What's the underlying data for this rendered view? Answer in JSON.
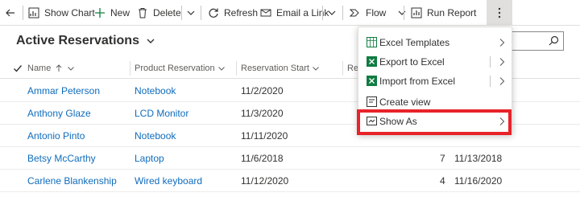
{
  "toolbar": {
    "show_chart": "Show Chart",
    "new": "New",
    "delete": "Delete",
    "refresh": "Refresh",
    "email_link": "Email a Link",
    "flow": "Flow",
    "run_report": "Run Report"
  },
  "view": {
    "title": "Active Reservations"
  },
  "columns": {
    "name": "Name",
    "product": "Product Reservation",
    "start": "Reservation Start",
    "fourth": "Res"
  },
  "rows": [
    {
      "name": "Ammar Peterson",
      "product": "Notebook",
      "start": "11/2/2020",
      "qty": "",
      "end": ""
    },
    {
      "name": "Anthony Glaze",
      "product": "LCD Monitor",
      "start": "11/3/2020",
      "qty": "",
      "end": ""
    },
    {
      "name": "Antonio Pinto",
      "product": "Notebook",
      "start": "11/11/2020",
      "qty": "",
      "end": ""
    },
    {
      "name": "Betsy McCarthy",
      "product": "Laptop",
      "start": "11/6/2018",
      "qty": "7",
      "end": "11/13/2018"
    },
    {
      "name": "Carlene Blankenship",
      "product": "Wired keyboard",
      "start": "11/12/2020",
      "qty": "4",
      "end": "11/16/2020"
    }
  ],
  "menu": {
    "items": [
      {
        "label": "Excel Templates"
      },
      {
        "label": "Export to Excel"
      },
      {
        "label": "Import from Excel"
      },
      {
        "label": "Create view"
      },
      {
        "label": "Show As"
      }
    ]
  },
  "colors": {
    "link": "#0f6cbd",
    "excel_green": "#107c41",
    "highlight": "#e8232a"
  }
}
